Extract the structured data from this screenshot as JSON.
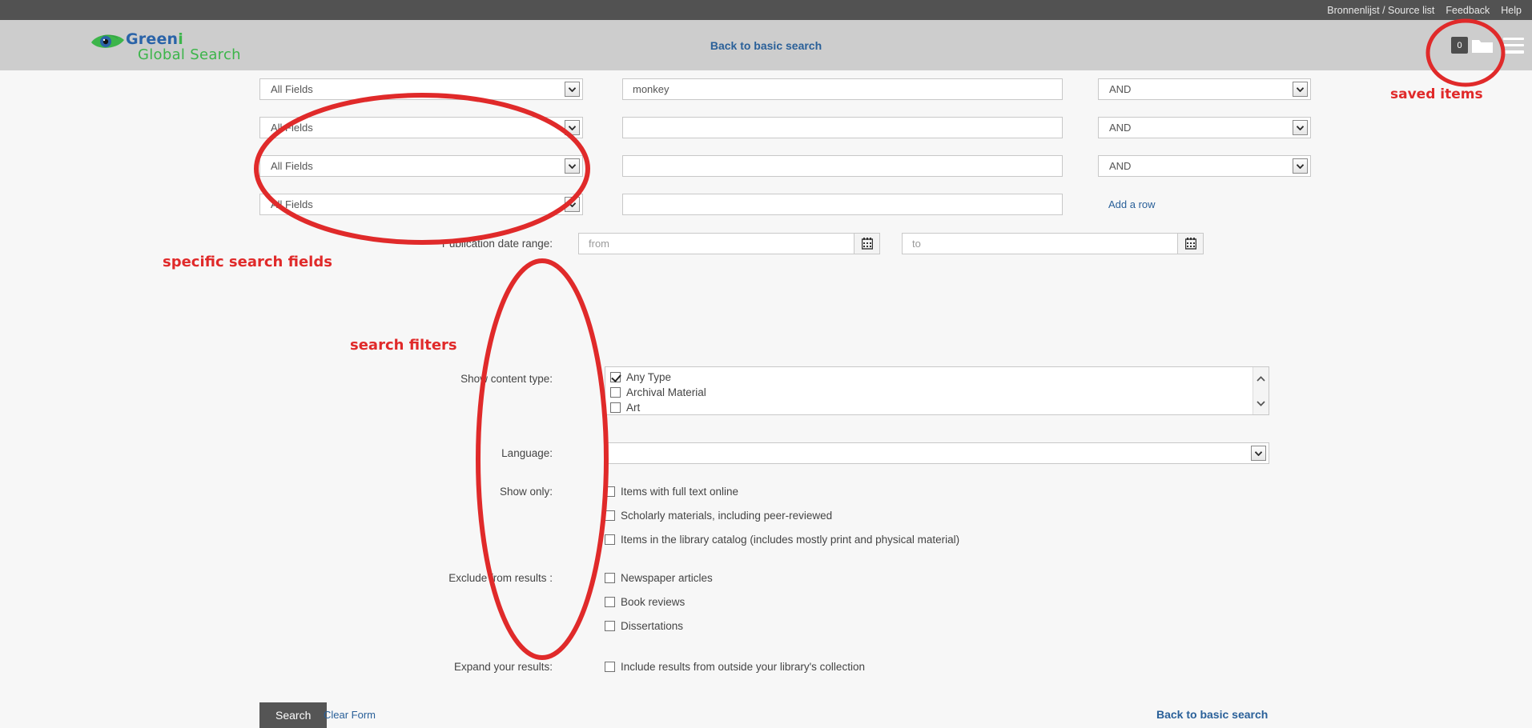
{
  "topbar": {
    "links": [
      {
        "label": "Bronnenlijst / Source list"
      },
      {
        "label": "Feedback"
      },
      {
        "label": "Help"
      }
    ]
  },
  "header": {
    "logo": {
      "brand_blue": "Green",
      "brand_green": "i",
      "subtitle": "Global Search"
    },
    "center_link": "Back to basic search",
    "saved_items_count": "0"
  },
  "annotations": {
    "saved_items": "saved items",
    "specific_search_fields": "specific search fields",
    "search_filters": "search filters",
    "color": "#e02a2a"
  },
  "form": {
    "search_rows": [
      {
        "field": "All Fields",
        "term": "monkey",
        "term_placeholder": "",
        "operator": "AND"
      },
      {
        "field": "All Fields",
        "term": "",
        "term_placeholder": "",
        "operator": "AND"
      },
      {
        "field": "All Fields",
        "term": "",
        "term_placeholder": "",
        "operator": "AND"
      },
      {
        "field": "All Fields",
        "term": "",
        "term_placeholder": "",
        "operator": ""
      }
    ],
    "add_row_label": "Add a row",
    "date_range": {
      "label": "Publication date range:",
      "from_value": "",
      "from_placeholder": "from",
      "to_value": "",
      "to_placeholder": "to"
    },
    "content_type": {
      "label": "Show content type:",
      "options": [
        {
          "label": "Any Type",
          "checked": true
        },
        {
          "label": "Archival Material",
          "checked": false
        },
        {
          "label": "Art",
          "checked": false
        }
      ]
    },
    "language": {
      "label": "Language:",
      "value": ""
    },
    "show_only": {
      "label": "Show only:",
      "options": [
        {
          "label": "Items with full text online",
          "checked": false
        },
        {
          "label": "Scholarly materials, including peer-reviewed",
          "checked": false
        },
        {
          "label": "Items in the library catalog (includes mostly print and physical material)",
          "checked": false
        }
      ]
    },
    "exclude": {
      "label": "Exclude from results :",
      "options": [
        {
          "label": "Newspaper articles",
          "checked": false
        },
        {
          "label": "Book reviews",
          "checked": false
        },
        {
          "label": "Dissertations",
          "checked": false
        }
      ]
    },
    "expand": {
      "label": "Expand your results:",
      "options": [
        {
          "label": "Include results from outside your library's collection",
          "checked": false
        }
      ]
    },
    "search_button": "Search",
    "clear_form_label": "Clear Form",
    "back_to_basic_label": "Back to basic search"
  }
}
